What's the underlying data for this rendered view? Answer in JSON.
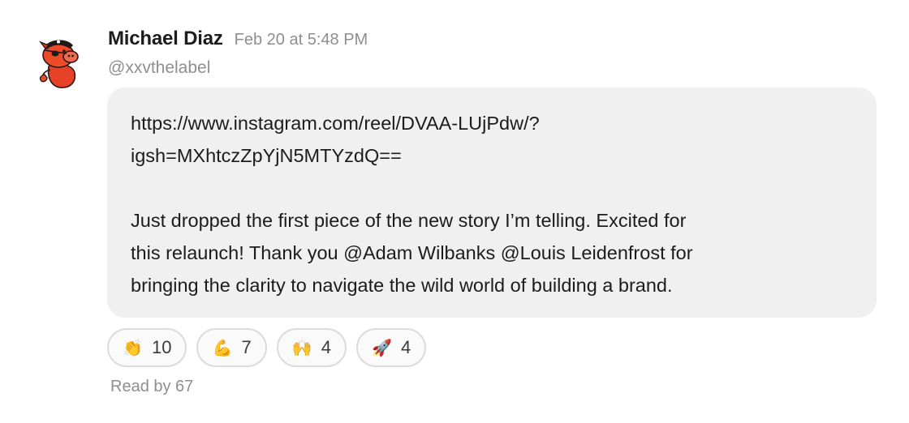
{
  "message": {
    "author": "Michael Diaz",
    "timestamp": "Feb 20 at 5:48 PM",
    "handle": "@xxvthelabel",
    "link_line_1": "https://www.instagram.com/reel/DVAA-LUjPdw/?",
    "link_line_2": "igsh=MXhtczZpYjN5MTYzdQ==",
    "body_line_1": "Just dropped the first piece of the new story I’m telling. Excited for",
    "body_line_2": "this relaunch! Thank you @Adam Wilbanks @Louis Leidenfrost for",
    "body_line_3": "bringing the clarity to navigate the wild world of building a brand."
  },
  "avatar": {
    "icon": "pirate-pig-avatar-icon",
    "color": "#ee4b2b"
  },
  "reactions": [
    {
      "emoji": "👏",
      "icon": "clapping-hands-emoji",
      "count": "10"
    },
    {
      "emoji": "💪",
      "icon": "flexed-biceps-emoji",
      "count": "7"
    },
    {
      "emoji": "🙌",
      "icon": "raising-hands-emoji",
      "count": "4"
    },
    {
      "emoji": "🚀",
      "icon": "rocket-emoji",
      "count": "4"
    }
  ],
  "read_receipt": "Read by 67"
}
